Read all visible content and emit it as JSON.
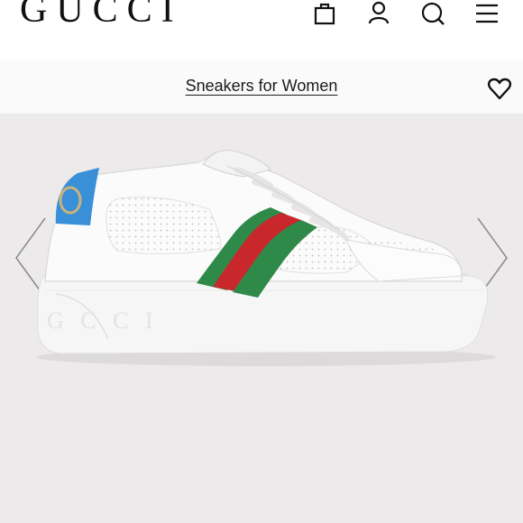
{
  "header": {
    "logo": "GUCCI",
    "icons": [
      "shopping-bag-icon",
      "user-icon",
      "search-icon",
      "menu-icon"
    ]
  },
  "subheader": {
    "title": "Sneakers for Women",
    "wishlist_icon": "heart-icon"
  },
  "product": {
    "image_alt": "White leather platform sneaker with green-red-green Web stripe and blue heel tab",
    "sole_text": "GUCCI"
  },
  "gallery": {
    "prev_icon": "chevron-left-icon",
    "next_icon": "chevron-right-icon"
  },
  "colors": {
    "background": "#eceaea",
    "stripe_green": "#2f8a4a",
    "stripe_red": "#c8282b",
    "heel_blue": "#3a8fd9",
    "heel_logo_gold": "#c9b37a"
  }
}
